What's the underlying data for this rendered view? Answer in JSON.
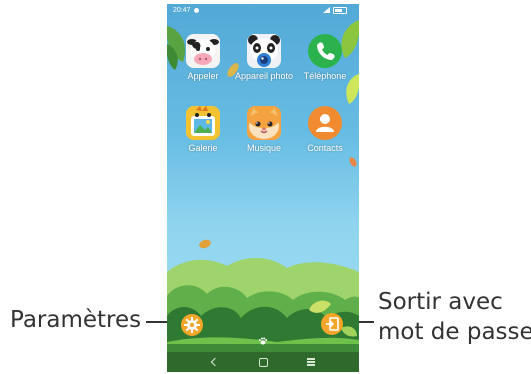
{
  "callouts": {
    "settings_label": "Paramètres",
    "exit_label_line1": "Sortir avec",
    "exit_label_line2": "mot de passe"
  },
  "statusbar": {
    "time": "20:47"
  },
  "apps": [
    {
      "label": "Appeler",
      "icon": "cow-icon"
    },
    {
      "label": "Appareil photo",
      "icon": "panda-camera-icon"
    },
    {
      "label": "Téléphone",
      "icon": "phone-icon"
    },
    {
      "label": "Galerie",
      "icon": "bird-gallery-icon"
    },
    {
      "label": "Musique",
      "icon": "cat-music-icon"
    },
    {
      "label": "Contacts",
      "icon": "contacts-icon"
    }
  ],
  "buttons": {
    "settings_icon": "gear-icon",
    "exit_icon": "exit-door-icon"
  },
  "navbar": {
    "back_icon": "back-icon",
    "home_icon": "home-icon",
    "recent_icon": "recent-apps-icon"
  },
  "colors": {
    "sky_top": "#52a9d6",
    "accent_orange": "#f3a72a",
    "phone_green": "#2bb24c",
    "contacts_orange": "#f08b2f",
    "grass_dark": "#2f6a2c",
    "grass_light": "#6cc24a"
  }
}
